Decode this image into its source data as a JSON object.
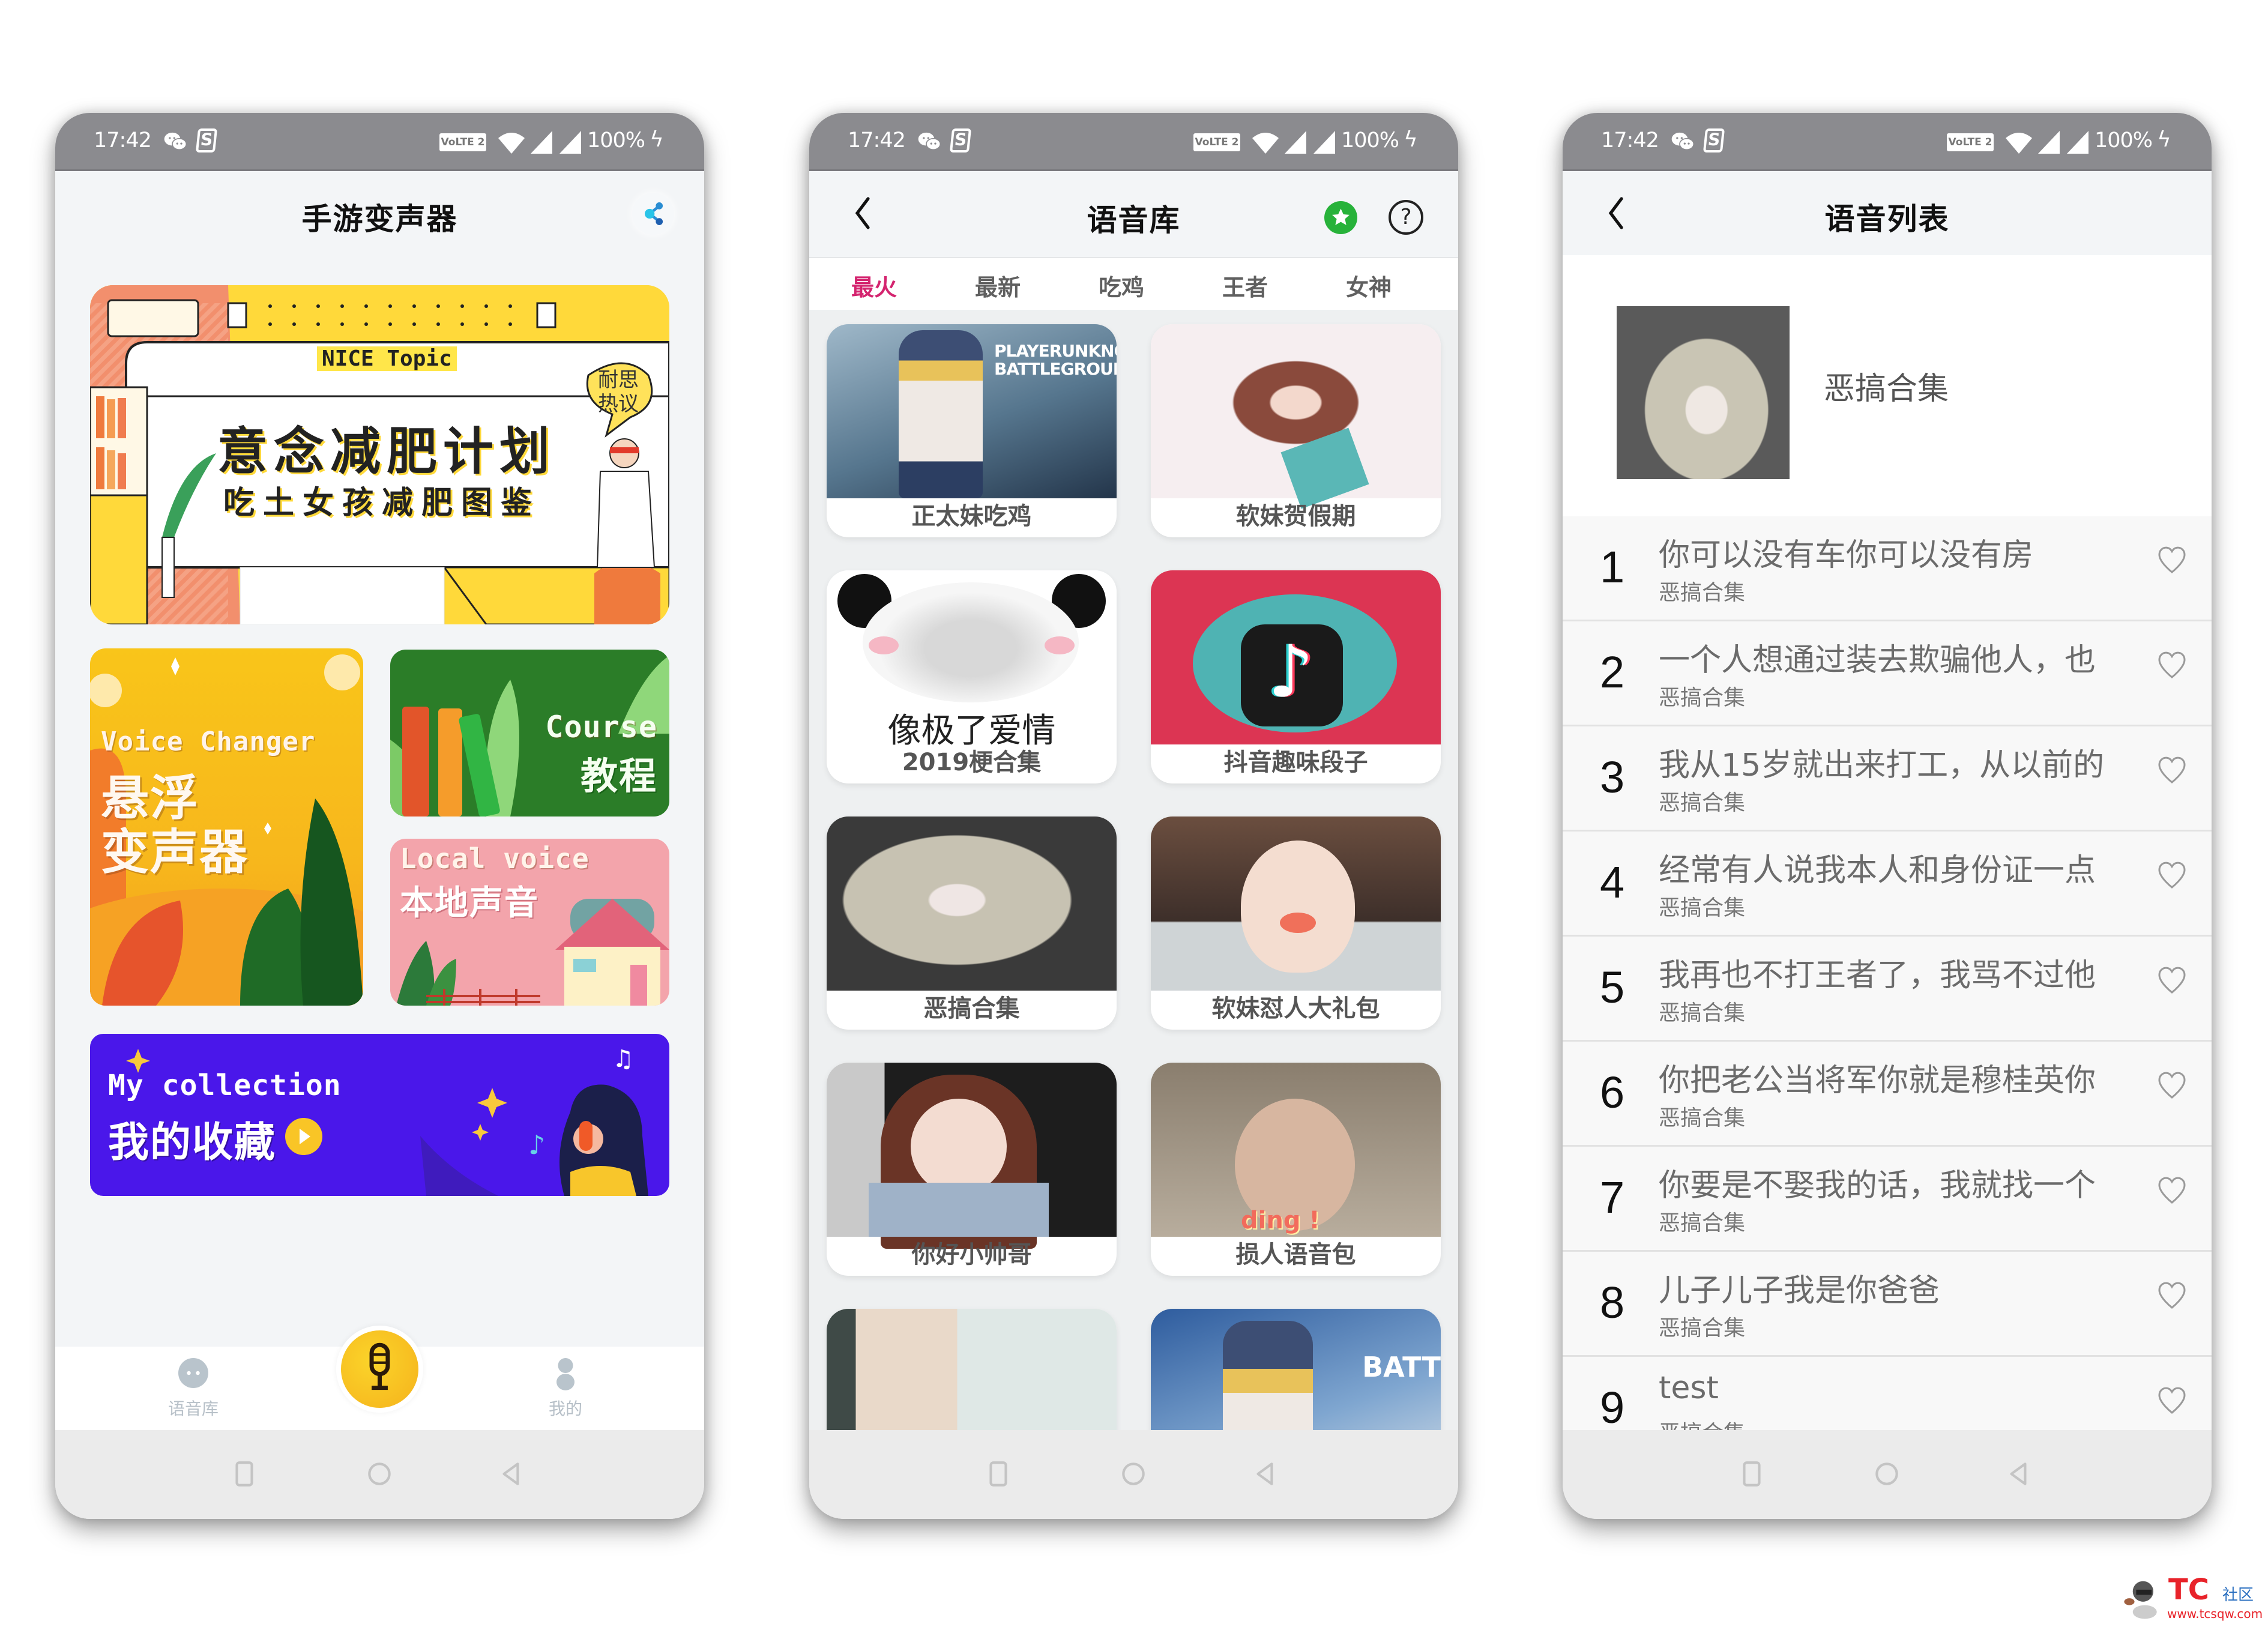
{
  "status_bar": {
    "time": "17:42",
    "volte": "VoLTE 2",
    "battery": "100%",
    "icons": [
      "wechat-icon",
      "sogou-s-icon",
      "volte-icon",
      "wifi-icon",
      "signal-icon",
      "signal-icon",
      "charging-bolt-icon"
    ]
  },
  "nav_bar": {
    "buttons": [
      "recent-apps",
      "home",
      "back"
    ]
  },
  "phone1": {
    "title": "手游变声器",
    "share_icon": "share-icon",
    "banner": {
      "tag": "NICE Topic",
      "headline": "意念减肥计划",
      "subline": "吃土女孩减肥图鉴",
      "bubble_line1": "耐思",
      "bubble_line2": "热议"
    },
    "cards": {
      "voice": {
        "en": "Voice Changer",
        "cn1": "悬浮",
        "cn2": "变声器"
      },
      "course": {
        "en": "Course",
        "cn": "教程"
      },
      "local": {
        "en": "Local voice",
        "cn": "本地声音"
      },
      "collection": {
        "en": "My collection",
        "cn": "我的收藏"
      }
    },
    "tabbar": {
      "left": "语音库",
      "center_icon": "microphone-icon",
      "right": "我的"
    }
  },
  "phone2": {
    "title": "语音库",
    "tabs": [
      "最火",
      "最新",
      "吃鸡",
      "王者",
      "女神"
    ],
    "active_tab": "最火",
    "accent_color": "#d4246f",
    "grid": [
      {
        "caption": "正太妹吃鸡",
        "image_text": "PLAYERUNKNOWN'S BATTLEGROUNDS"
      },
      {
        "caption": "软妹贺假期",
        "image_text": ""
      },
      {
        "caption": "2019梗合集",
        "image_text": "像极了爱情"
      },
      {
        "caption": "抖音趣味段子",
        "image_text": ""
      },
      {
        "caption": "恶搞合集",
        "image_text": ""
      },
      {
        "caption": "软妹怼人大礼包",
        "image_text": ""
      },
      {
        "caption": "你好小帅哥",
        "image_text": ""
      },
      {
        "caption": "损人语音包",
        "image_text": "ding !"
      },
      {
        "caption": "",
        "image_text": ""
      },
      {
        "caption": "",
        "image_text": "BATT"
      }
    ]
  },
  "phone3": {
    "title": "语音列表",
    "hero_title": "恶搞合集",
    "items": [
      {
        "num": "1",
        "title": "你可以没有车你可以没有房",
        "sub": "恶搞合集"
      },
      {
        "num": "2",
        "title": "一个人想通过装去欺骗他人，也",
        "sub": "恶搞合集"
      },
      {
        "num": "3",
        "title": "我从15岁就出来打工，从以前的",
        "sub": "恶搞合集"
      },
      {
        "num": "4",
        "title": "经常有人说我本人和身份证一点",
        "sub": "恶搞合集"
      },
      {
        "num": "5",
        "title": "我再也不打王者了，我骂不过他",
        "sub": "恶搞合集"
      },
      {
        "num": "6",
        "title": "你把老公当将军你就是穆桂英你",
        "sub": "恶搞合集"
      },
      {
        "num": "7",
        "title": "你要是不娶我的话，我就找一个",
        "sub": "恶搞合集"
      },
      {
        "num": "8",
        "title": "儿子儿子我是你爸爸",
        "sub": "恶搞合集"
      },
      {
        "num": "9",
        "title": "test",
        "sub": "恶搞合集"
      }
    ]
  },
  "watermark": {
    "brand": "TC",
    "suffix": "社区",
    "url": "www.tcsqw.com"
  }
}
